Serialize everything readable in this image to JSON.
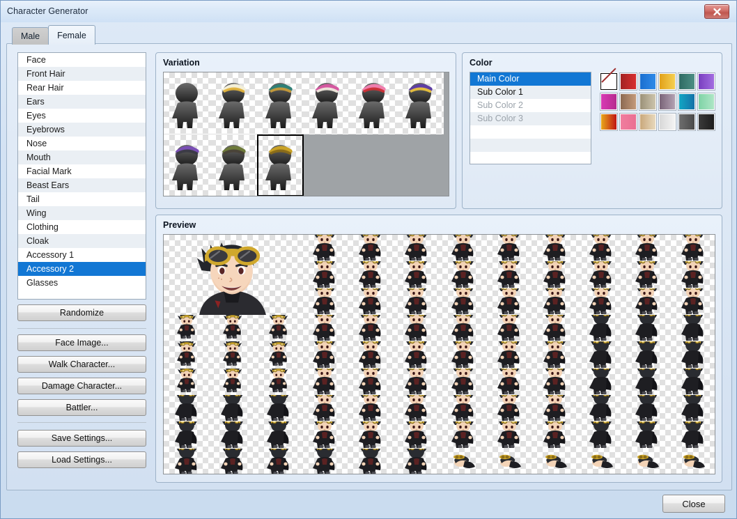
{
  "window": {
    "title": "Character Generator",
    "close_icon": "close-x-icon"
  },
  "tabs": [
    {
      "label": "Male",
      "active": false
    },
    {
      "label": "Female",
      "active": true
    }
  ],
  "parts_list": {
    "items": [
      "Face",
      "Front Hair",
      "Rear Hair",
      "Ears",
      "Eyes",
      "Eyebrows",
      "Nose",
      "Mouth",
      "Facial Mark",
      "Beast Ears",
      "Tail",
      "Wing",
      "Clothing",
      "Cloak",
      "Accessory 1",
      "Accessory 2",
      "Glasses"
    ],
    "selected": "Accessory 2",
    "selected_index": 15
  },
  "buttons": {
    "randomize": "Randomize",
    "face_image": "Face Image...",
    "walk_character": "Walk Character...",
    "damage_character": "Damage Character...",
    "battler": "Battler...",
    "save_settings": "Save Settings...",
    "load_settings": "Load Settings...",
    "close": "Close"
  },
  "variation": {
    "title": "Variation",
    "columns": 6,
    "selected_index": 8,
    "items": [
      {
        "name": "none",
        "accent": null,
        "accent2": null
      },
      {
        "name": "white-hairclip",
        "accent": "#f3efd8",
        "accent2": "#e0b23c"
      },
      {
        "name": "teal-witch-hat",
        "accent": "#2f7f76",
        "accent2": "#c79b3a"
      },
      {
        "name": "pink-bonnet",
        "accent": "#d459a0",
        "accent2": "#f0e9dd"
      },
      {
        "name": "rose-flower-hat",
        "accent": "#ef7fae",
        "accent2": "#cc2f35"
      },
      {
        "name": "purple-sun-hat",
        "accent": "#5d3ea3",
        "accent2": "#e9c23c"
      },
      {
        "name": "purple-ribbon",
        "accent": "#7a4fb5",
        "accent2": "#3a3a44"
      },
      {
        "name": "olive-headset",
        "accent": "#6d7a3a",
        "accent2": "#4a4238"
      },
      {
        "name": "gold-goggles",
        "accent": "#c9a227",
        "accent2": "#8a6c18"
      }
    ]
  },
  "color": {
    "title": "Color",
    "list": [
      {
        "label": "Main Color",
        "state": "selected"
      },
      {
        "label": "Sub Color 1",
        "state": "enabled"
      },
      {
        "label": "Sub Color 2",
        "state": "disabled"
      },
      {
        "label": "Sub Color 3",
        "state": "disabled"
      }
    ],
    "selected_swatch_index": 0,
    "swatches": [
      {
        "name": "none",
        "from": "#ffffff",
        "to": "#ffffff"
      },
      {
        "name": "red",
        "from": "#a32222",
        "to": "#d82f2f"
      },
      {
        "name": "blue",
        "from": "#1a6fd0",
        "to": "#2f8ae8"
      },
      {
        "name": "gold",
        "from": "#e2a219",
        "to": "#f5cf52"
      },
      {
        "name": "teal",
        "from": "#2f6b63",
        "to": "#4d8f84"
      },
      {
        "name": "purple",
        "from": "#7a3fc0",
        "to": "#a26de0"
      },
      {
        "name": "magenta",
        "from": "#d83bb5",
        "to": "#b62a8e"
      },
      {
        "name": "brown",
        "from": "#8c6a52",
        "to": "#c49a7a"
      },
      {
        "name": "khaki",
        "from": "#9b9178",
        "to": "#cdc5ad"
      },
      {
        "name": "mauve",
        "from": "#7a6478",
        "to": "#b3a2b3"
      },
      {
        "name": "cyan",
        "from": "#12a6c4",
        "to": "#1571a8"
      },
      {
        "name": "mint",
        "from": "#7fd3a6",
        "to": "#aee6c6"
      },
      {
        "name": "fire-red",
        "from": "#e8a81a",
        "to": "#c01414"
      },
      {
        "name": "pink",
        "from": "#f07d9e",
        "to": "#ea6f92"
      },
      {
        "name": "tan",
        "from": "#c9a87c",
        "to": "#e8d9bd"
      },
      {
        "name": "silver",
        "from": "#d8d8d8",
        "to": "#f4f4f4"
      },
      {
        "name": "gray",
        "from": "#6e6e6e",
        "to": "#4a4a4a"
      },
      {
        "name": "black",
        "from": "#3a3a3a",
        "to": "#1d1d1d"
      }
    ]
  },
  "preview": {
    "title": "Preview",
    "grid_columns": 12,
    "grid_rows": 9,
    "face_span_cols": 3,
    "face_span_rows": 3,
    "face": {
      "name": "character-face-portrait",
      "hair": "#24262b",
      "skin": "#f6d6bc",
      "goggles": "#d0a82c",
      "coat": "#2b2b30"
    },
    "sprite_palette": {
      "hair": "#2a2c31",
      "hair_light": "#4b4e55",
      "skin": "#f3d3b6",
      "goggles": "#c9a227",
      "goggles_dark": "#8a6c18",
      "cloak": "#1e1e22",
      "shirt": "#5a2222",
      "boots": "#4a4a50"
    },
    "sprite_rows": [
      {
        "kind": "face-block",
        "sprites": [
          "front-a",
          "front-b",
          "front-c",
          "front-a",
          "front-b",
          "front-c",
          "front-a",
          "front-b",
          "front-c"
        ]
      },
      {
        "kind": "face-block",
        "sprites": [
          "front-a",
          "front-b",
          "front-c",
          "front-a",
          "front-b",
          "front-c",
          "front-a",
          "front-b",
          "front-c"
        ]
      },
      {
        "kind": "face-block",
        "sprites": [
          "front-a",
          "front-b",
          "front-c",
          "front-a",
          "front-b",
          "front-c",
          "front-a",
          "front-b",
          "front-c"
        ]
      },
      {
        "kind": "walk",
        "sprites": [
          "walk-s1",
          "walk-s2",
          "walk-s3",
          "front-a",
          "front-b",
          "front-c",
          "front-a",
          "front-b",
          "front-c",
          "back-a",
          "back-b",
          "back-c"
        ]
      },
      {
        "kind": "walk",
        "sprites": [
          "walk-l1",
          "walk-l2",
          "walk-l3",
          "front-a",
          "front-b",
          "front-c",
          "front-a",
          "front-b",
          "front-c",
          "back-a",
          "back-b",
          "back-c"
        ]
      },
      {
        "kind": "walk",
        "sprites": [
          "walk-r1",
          "walk-r2",
          "walk-r3",
          "front-a",
          "front-b",
          "front-c",
          "front-a",
          "front-b",
          "front-c",
          "back-a",
          "back-b",
          "back-c"
        ]
      },
      {
        "kind": "back",
        "sprites": [
          "back-a",
          "back-b",
          "back-c",
          "front-a",
          "front-b",
          "front-c",
          "front-a",
          "front-b",
          "front-c",
          "back-a",
          "back-b",
          "back-c"
        ]
      },
      {
        "kind": "back",
        "sprites": [
          "hood-a",
          "hood-b",
          "hood-c",
          "front-a",
          "front-b",
          "front-c",
          "front-a",
          "front-b",
          "front-c",
          "back-a",
          "back-b",
          "back-c"
        ]
      },
      {
        "kind": "down",
        "sprites": [
          "down-a",
          "down-b",
          "down-c",
          "down-a",
          "down-b",
          "down-c",
          "lie-a",
          "lie-b",
          "lie-c",
          "lie-a",
          "lie-b",
          "lie-c"
        ]
      }
    ]
  }
}
